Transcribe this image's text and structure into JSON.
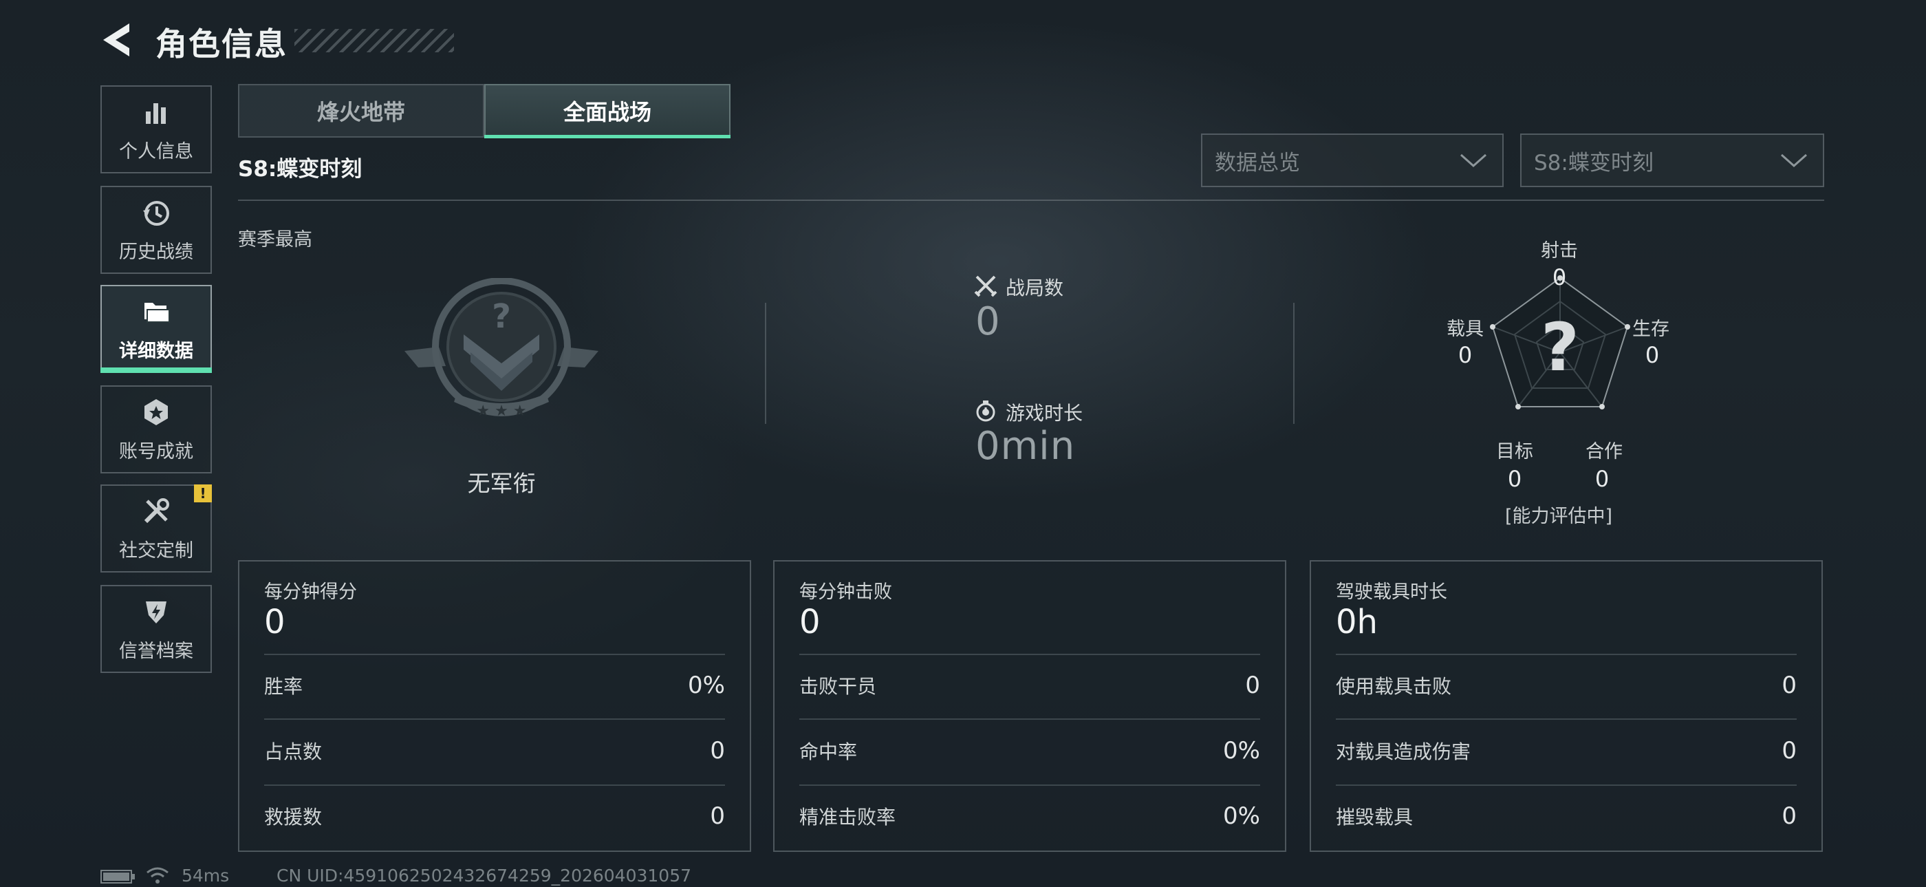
{
  "header": {
    "title": "角色信息"
  },
  "sidebar": {
    "items": [
      {
        "label": "个人信息",
        "icon": "bar-chart-icon"
      },
      {
        "label": "历史战绩",
        "icon": "history-icon"
      },
      {
        "label": "详细数据",
        "icon": "folder-icon",
        "active": true
      },
      {
        "label": "账号成就",
        "icon": "medal-icon"
      },
      {
        "label": "社交定制",
        "icon": "tools-icon",
        "badge": "!"
      },
      {
        "label": "信誉档案",
        "icon": "shield-bolt-icon"
      }
    ]
  },
  "tabs": [
    {
      "label": "烽火地带",
      "active": false
    },
    {
      "label": "全面战场",
      "active": true
    }
  ],
  "season_title": "S8:蝶变时刻",
  "filters": {
    "view": "数据总览",
    "season": "S8:蝶变时刻"
  },
  "season_best": {
    "label": "赛季最高",
    "rank": "无军衔"
  },
  "summary": {
    "matches_label": "战局数",
    "matches_value": "0",
    "playtime_label": "游戏时长",
    "playtime_value": "0min"
  },
  "radar": {
    "shooting": {
      "label": "射击",
      "value": "0"
    },
    "survival": {
      "label": "生存",
      "value": "0"
    },
    "teamwork": {
      "label": "合作",
      "value": "0"
    },
    "objective": {
      "label": "目标",
      "value": "0"
    },
    "vehicle": {
      "label": "载具",
      "value": "0"
    },
    "center_mark": "?",
    "status": "[能力评估中]"
  },
  "panels": [
    {
      "title": "每分钟得分",
      "value": "0",
      "rows": [
        {
          "label": "胜率",
          "value": "0%"
        },
        {
          "label": "占点数",
          "value": "0"
        },
        {
          "label": "救援数",
          "value": "0"
        }
      ]
    },
    {
      "title": "每分钟击败",
      "value": "0",
      "rows": [
        {
          "label": "击败干员",
          "value": "0"
        },
        {
          "label": "命中率",
          "value": "0%"
        },
        {
          "label": "精准击败率",
          "value": "0%"
        }
      ]
    },
    {
      "title": "驾驶载具时长",
      "value": "0h",
      "rows": [
        {
          "label": "使用载具击败",
          "value": "0"
        },
        {
          "label": "对载具造成伤害",
          "value": "0"
        },
        {
          "label": "摧毁载具",
          "value": "0"
        }
      ]
    }
  ],
  "footer": {
    "ping": "54ms",
    "uid": "CN UID:4591062502432674259_202604031057"
  },
  "colors": {
    "accent": "#5fe0b0",
    "badge": "#e8c23a"
  }
}
